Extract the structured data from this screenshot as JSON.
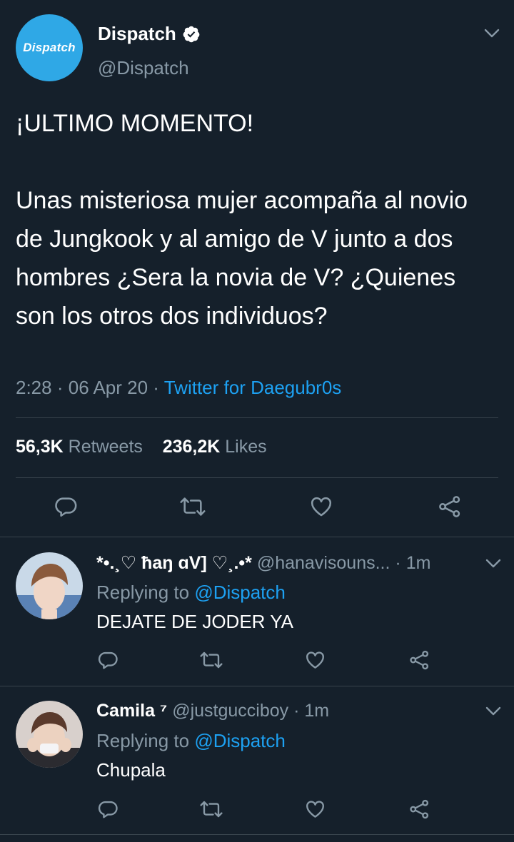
{
  "tweet": {
    "author_name": "Dispatch",
    "author_handle": "@Dispatch",
    "avatar_text": "Dispatch",
    "text": "¡ULTIMO MOMENTO!\n\nUnas misteriosa mujer acompaña al novio de Jungkook y al amigo de V junto a dos hombres ¿Sera la novia de V? ¿Quienes son los otros dos individuos?",
    "time": "2:28",
    "date": "06 Apr 20",
    "separator": "·",
    "source": "Twitter for Daegubr0s",
    "retweets_count": "56,3K",
    "retweets_label": "Retweets",
    "likes_count": "236,2K",
    "likes_label": "Likes"
  },
  "replies": [
    {
      "name": "*•.¸♡ ħaŋ ɑV] ♡¸.•*",
      "handle": "@hanavisouns...",
      "separator": "·",
      "time": "1m",
      "replying_prefix": "Replying to",
      "replying_to": "@Dispatch",
      "text": "DEJATE DE JODER YA"
    },
    {
      "name": "Camila ⁷",
      "handle": "@justgucciboy",
      "separator": "·",
      "time": "1m",
      "replying_prefix": "Replying to",
      "replying_to": "@Dispatch",
      "text": "Chupala"
    }
  ],
  "icons": {
    "reply": "reply-icon",
    "retweet": "retweet-icon",
    "like": "heart-icon",
    "share": "share-icon",
    "more": "chevron-down-icon",
    "verified": "verified-badge-icon"
  },
  "colors": {
    "background": "#15202b",
    "text": "#ffffff",
    "secondary": "#8899a6",
    "link": "#1da1f2",
    "divider": "#38444d",
    "avatar_brand": "#2fa8e6"
  }
}
